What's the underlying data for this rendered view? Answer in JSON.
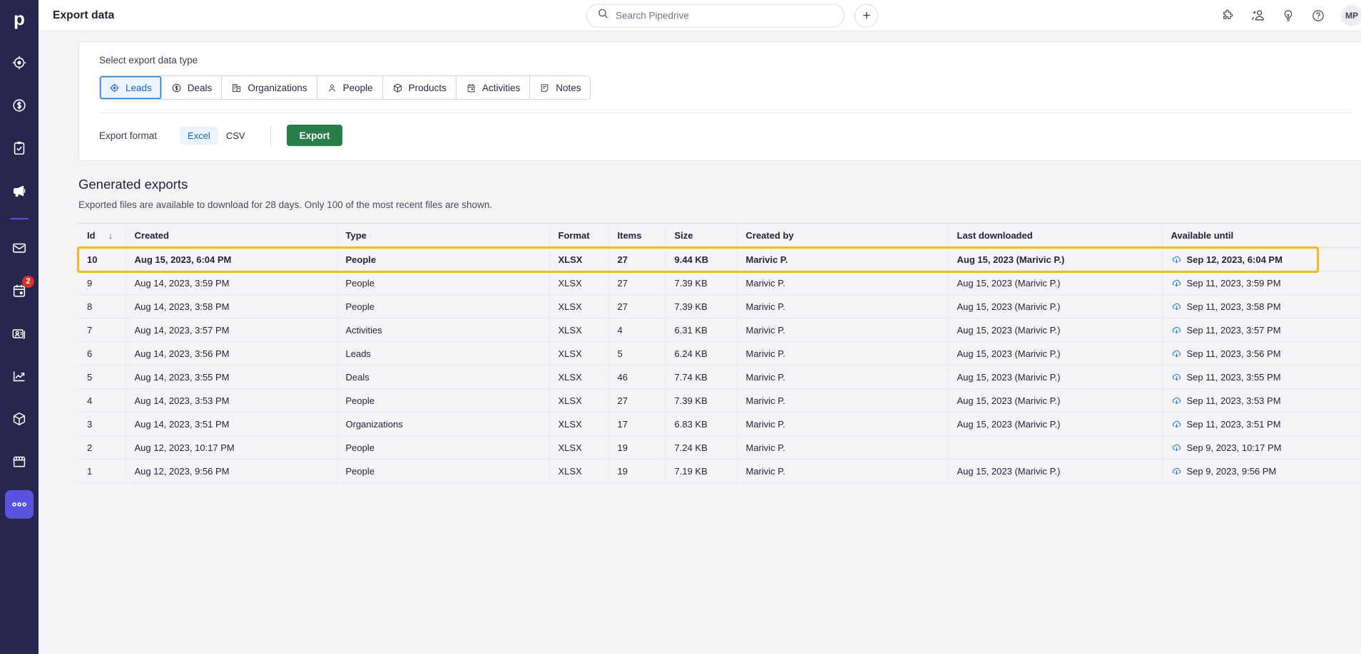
{
  "app": {
    "logo": "p",
    "brand_navy": "#26264f",
    "accent_purple": "#5b52e0",
    "accent_green": "#2a7f49",
    "accent_blue": "#1769c7",
    "highlight_yellow": "#f5b919"
  },
  "sidebar": {
    "items": [
      {
        "name": "leads",
        "icon": "target-icon",
        "label": "Leads",
        "badge": ""
      },
      {
        "name": "deals",
        "icon": "dollar-icon",
        "label": "Deals",
        "badge": ""
      },
      {
        "name": "activities",
        "icon": "clipboard-icon",
        "label": "Activities",
        "badge": ""
      },
      {
        "name": "campaigns",
        "icon": "megaphone-icon",
        "label": "Campaigns",
        "badge": ""
      },
      {
        "name": "mail",
        "icon": "envelope-icon",
        "label": "Mail",
        "badge": ""
      },
      {
        "name": "calendar",
        "icon": "calendar-icon",
        "label": "Calendar",
        "badge": "2"
      },
      {
        "name": "contacts",
        "icon": "contact-card-icon",
        "label": "Contacts",
        "badge": ""
      },
      {
        "name": "insights",
        "icon": "chart-line-icon",
        "label": "Insights",
        "badge": ""
      },
      {
        "name": "products",
        "icon": "cube-icon",
        "label": "Products",
        "badge": ""
      },
      {
        "name": "marketplace",
        "icon": "storefront-icon",
        "label": "Marketplace",
        "badge": ""
      },
      {
        "name": "more",
        "icon": "ellipsis-icon",
        "label": "More",
        "badge": ""
      }
    ],
    "calendar_badge": "2"
  },
  "header": {
    "title": "Export data",
    "search": {
      "placeholder": "Search Pipedrive",
      "value": ""
    },
    "add_button_label": "+",
    "icons": [
      "puzzle-icon",
      "add-person-icon",
      "lightbulb-icon",
      "help-icon"
    ],
    "avatar_initials": "MP"
  },
  "export_panel": {
    "section_label": "Select export data type",
    "tabs": [
      {
        "label": "Leads",
        "icon": "target-icon",
        "selected": true
      },
      {
        "label": "Deals",
        "icon": "dollar-icon",
        "selected": false
      },
      {
        "label": "Organizations",
        "icon": "building-icon",
        "selected": false
      },
      {
        "label": "People",
        "icon": "person-icon",
        "selected": false
      },
      {
        "label": "Products",
        "icon": "cube-icon",
        "selected": false
      },
      {
        "label": "Activities",
        "icon": "calendar-icon",
        "selected": false
      },
      {
        "label": "Notes",
        "icon": "note-icon",
        "selected": false
      }
    ],
    "format_label": "Export format",
    "formats": [
      {
        "label": "Excel",
        "selected": true
      },
      {
        "label": "CSV",
        "selected": false
      }
    ],
    "export_button": "Export"
  },
  "generated_exports": {
    "title": "Generated exports",
    "subtitle": "Exported files are available to download for 28 days. Only 100 of the most recent files are shown.",
    "columns": [
      "Id",
      "Created",
      "Type",
      "Format",
      "Items",
      "Size",
      "Created by",
      "Last downloaded",
      "Available until"
    ],
    "sort_indicator": "↓",
    "rows": [
      {
        "id": "10",
        "created": "Aug 15, 2023, 6:04 PM",
        "type": "People",
        "format": "XLSX",
        "items": "27",
        "size": "9.44 KB",
        "created_by": "Marivic P.",
        "last_downloaded": "Aug 15, 2023 (Marivic P.)",
        "available_until": "Sep 12, 2023, 6:04 PM",
        "highlighted": true
      },
      {
        "id": "9",
        "created": "Aug 14, 2023, 3:59 PM",
        "type": "People",
        "format": "XLSX",
        "items": "27",
        "size": "7.39 KB",
        "created_by": "Marivic P.",
        "last_downloaded": "Aug 15, 2023 (Marivic P.)",
        "available_until": "Sep 11, 2023, 3:59 PM",
        "highlighted": false
      },
      {
        "id": "8",
        "created": "Aug 14, 2023, 3:58 PM",
        "type": "People",
        "format": "XLSX",
        "items": "27",
        "size": "7.39 KB",
        "created_by": "Marivic P.",
        "last_downloaded": "Aug 15, 2023 (Marivic P.)",
        "available_until": "Sep 11, 2023, 3:58 PM",
        "highlighted": false
      },
      {
        "id": "7",
        "created": "Aug 14, 2023, 3:57 PM",
        "type": "Activities",
        "format": "XLSX",
        "items": "4",
        "size": "6.31 KB",
        "created_by": "Marivic P.",
        "last_downloaded": "Aug 15, 2023 (Marivic P.)",
        "available_until": "Sep 11, 2023, 3:57 PM",
        "highlighted": false
      },
      {
        "id": "6",
        "created": "Aug 14, 2023, 3:56 PM",
        "type": "Leads",
        "format": "XLSX",
        "items": "5",
        "size": "6.24 KB",
        "created_by": "Marivic P.",
        "last_downloaded": "Aug 15, 2023 (Marivic P.)",
        "available_until": "Sep 11, 2023, 3:56 PM",
        "highlighted": false
      },
      {
        "id": "5",
        "created": "Aug 14, 2023, 3:55 PM",
        "type": "Deals",
        "format": "XLSX",
        "items": "46",
        "size": "7.74 KB",
        "created_by": "Marivic P.",
        "last_downloaded": "Aug 15, 2023 (Marivic P.)",
        "available_until": "Sep 11, 2023, 3:55 PM",
        "highlighted": false
      },
      {
        "id": "4",
        "created": "Aug 14, 2023, 3:53 PM",
        "type": "People",
        "format": "XLSX",
        "items": "27",
        "size": "7.39 KB",
        "created_by": "Marivic P.",
        "last_downloaded": "Aug 15, 2023 (Marivic P.)",
        "available_until": "Sep 11, 2023, 3:53 PM",
        "highlighted": false
      },
      {
        "id": "3",
        "created": "Aug 14, 2023, 3:51 PM",
        "type": "Organizations",
        "format": "XLSX",
        "items": "17",
        "size": "6.83 KB",
        "created_by": "Marivic P.",
        "last_downloaded": "Aug 15, 2023 (Marivic P.)",
        "available_until": "Sep 11, 2023, 3:51 PM",
        "highlighted": false
      },
      {
        "id": "2",
        "created": "Aug 12, 2023, 10:17 PM",
        "type": "People",
        "format": "XLSX",
        "items": "19",
        "size": "7.24 KB",
        "created_by": "Marivic P.",
        "last_downloaded": "",
        "available_until": "Sep 9, 2023, 10:17 PM",
        "highlighted": false
      },
      {
        "id": "1",
        "created": "Aug 12, 2023, 9:56 PM",
        "type": "People",
        "format": "XLSX",
        "items": "19",
        "size": "7.19 KB",
        "created_by": "Marivic P.",
        "last_downloaded": "Aug 15, 2023 (Marivic P.)",
        "available_until": "Sep 9, 2023, 9:56 PM",
        "highlighted": false
      }
    ]
  }
}
